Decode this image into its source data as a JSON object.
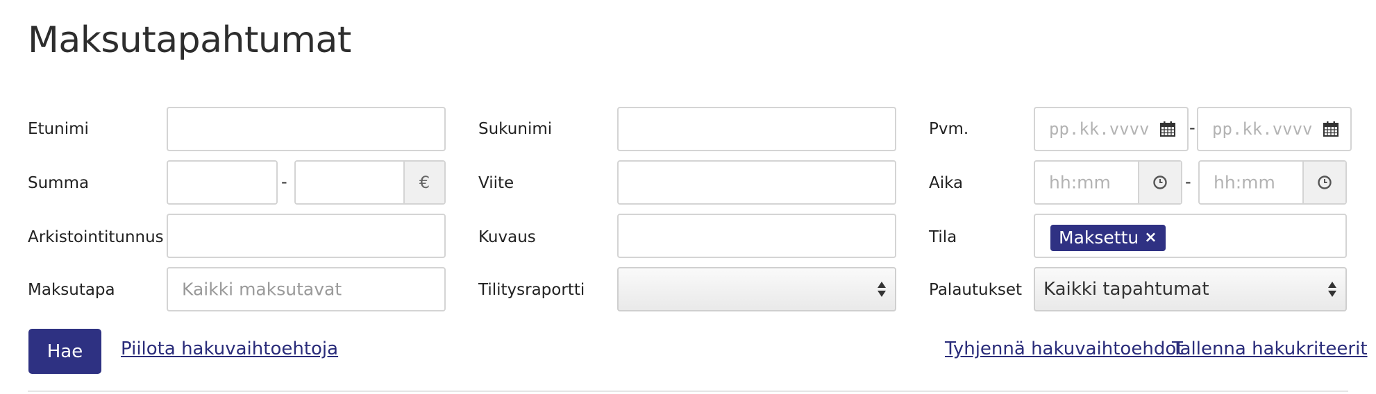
{
  "page": {
    "title": "Maksutapahtumat"
  },
  "col1": {
    "etunimi_label": "Etunimi",
    "summa_label": "Summa",
    "summa_separator": "-",
    "currency_symbol": "€",
    "arkistointitunnus_label": "Arkistointitunnus",
    "maksutapa_label": "Maksutapa",
    "maksutapa_placeholder": "Kaikki maksutavat"
  },
  "col2": {
    "sukunimi_label": "Sukunimi",
    "viite_label": "Viite",
    "kuvaus_label": "Kuvaus",
    "tilitysraportti_label": "Tilitysraportti",
    "tilitysraportti_value": ""
  },
  "col3": {
    "pvm_label": "Pvm.",
    "date_placeholder": "pp.kk.vvvv",
    "range_separator": "-",
    "aika_label": "Aika",
    "time_placeholder": "hh:mm",
    "tila_label": "Tila",
    "tila_tags": [
      "Maksettu"
    ],
    "tag_remove": "×",
    "palautukset_label": "Palautukset",
    "palautukset_value": "Kaikki tapahtumat"
  },
  "actions": {
    "search_button": "Hae",
    "hide_options_link": "Piilota hakuvaihtoehtoja",
    "clear_link": "Tyhjennä hakuvaihtoehdot",
    "save_link": "Tallenna hakukriteerit"
  },
  "icons": {
    "date_picker": "calendar-icon",
    "time_picker": "clock-icon",
    "select_arrows": "sort-arrows-icon"
  },
  "colors": {
    "primary": "#2e3182",
    "link": "#2a2c7a",
    "border": "#d4d4d4"
  }
}
